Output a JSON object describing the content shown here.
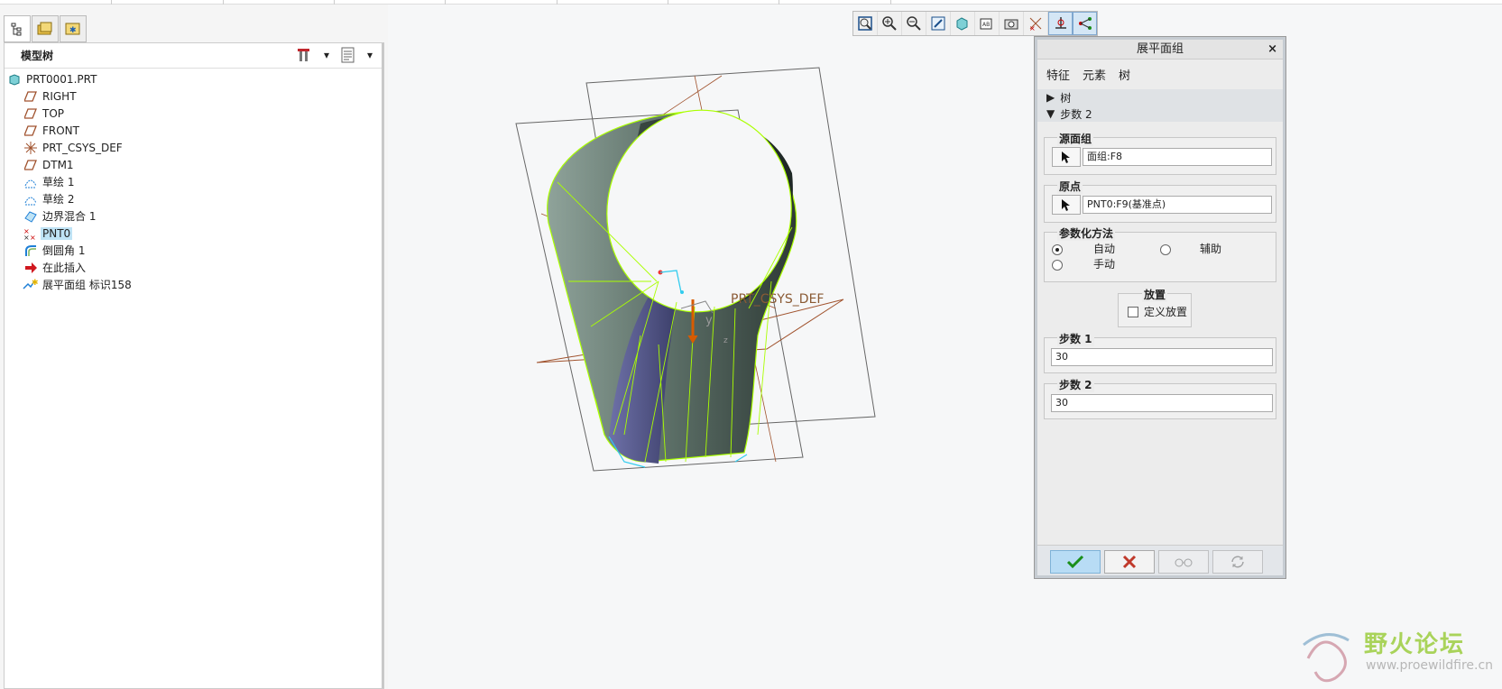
{
  "left_panel": {
    "header_title": "模型树",
    "tree_items": [
      {
        "label": "PRT0001.PRT",
        "icon": "part-icon"
      },
      {
        "label": "RIGHT",
        "icon": "datum-plane-icon"
      },
      {
        "label": "TOP",
        "icon": "datum-plane-icon"
      },
      {
        "label": "FRONT",
        "icon": "datum-plane-icon"
      },
      {
        "label": "PRT_CSYS_DEF",
        "icon": "csys-icon"
      },
      {
        "label": "DTM1",
        "icon": "datum-plane-icon"
      },
      {
        "label": "草绘 1",
        "icon": "sketch-icon"
      },
      {
        "label": "草绘 2",
        "icon": "sketch-icon"
      },
      {
        "label": "边界混合 1",
        "icon": "boundary-blend-icon"
      },
      {
        "label": "PNT0",
        "icon": "datum-point-icon",
        "selected": true
      },
      {
        "label": "倒圆角 1",
        "icon": "round-icon"
      },
      {
        "label": "在此插入",
        "icon": "insert-here-icon"
      },
      {
        "label": "展平面组 标识158",
        "icon": "flatten-quilt-icon"
      }
    ]
  },
  "viewport": {
    "csys_label": "PRT_CSYS_DEF",
    "axis_y": "y",
    "axis_z": "z"
  },
  "dialog": {
    "title": "展平面组",
    "close": "×",
    "tabs": [
      "特征",
      "元素",
      "树"
    ],
    "sections": {
      "tree": "树",
      "steps": "步数 2"
    },
    "source_quilt": {
      "label": "源面组",
      "value": "面组:F8"
    },
    "origin": {
      "label": "原点",
      "value": "PNT0:F9(基准点)"
    },
    "param_method": {
      "label": "参数化方法",
      "auto": "自动",
      "aux": "辅助",
      "manual": "手动",
      "selected": "自动"
    },
    "placement": {
      "label": "放置",
      "define": "定义放置"
    },
    "steps1": {
      "label": "步数 1",
      "value": "30"
    },
    "steps2": {
      "label": "步数 2",
      "value": "30"
    }
  },
  "watermark": {
    "cn": "野火论坛",
    "en": "www.proewildfire.cn"
  },
  "colors": {
    "accent": "#1e7fd6",
    "ok_green": "#1a8f1a",
    "cancel_red": "#c0392b",
    "highlight_green": "#aaff00",
    "surface": "#5b6e66"
  }
}
